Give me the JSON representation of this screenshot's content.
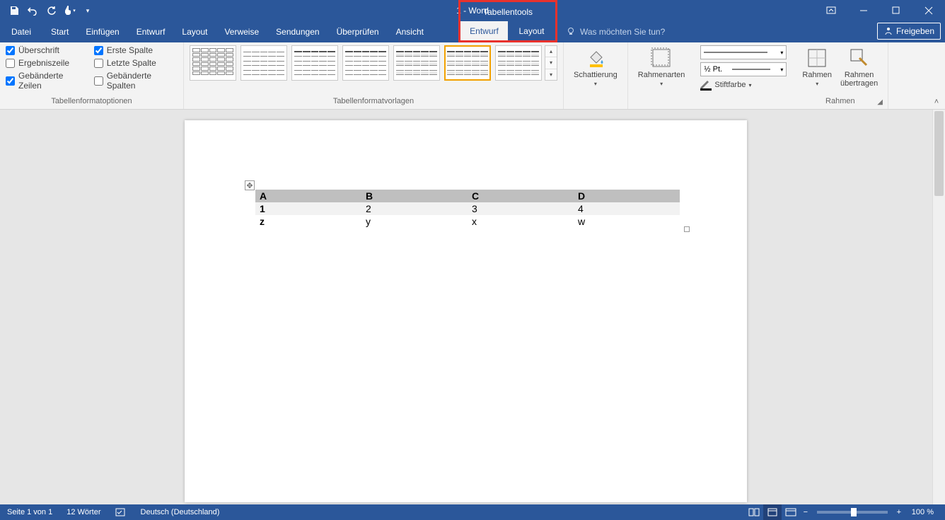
{
  "title": "1 - Word",
  "tabletools_label": "Tabellentools",
  "tabs": {
    "file": "Datei",
    "start": "Start",
    "insert": "Einfügen",
    "design": "Entwurf",
    "layout": "Layout",
    "references": "Verweise",
    "mailings": "Sendungen",
    "review": "Überprüfen",
    "view": "Ansicht",
    "ctx_design": "Entwurf",
    "ctx_layout": "Layout"
  },
  "tell_me_placeholder": "Was möchten Sie tun?",
  "share_label": "Freigeben",
  "groups": {
    "style_options": "Tabellenformatoptionen",
    "table_styles": "Tabellenformatvorlagen",
    "borders": "Rahmen"
  },
  "options": {
    "header_row": "Überschrift",
    "total_row": "Ergebniszeile",
    "banded_rows": "Gebänderte Zeilen",
    "first_col": "Erste Spalte",
    "last_col": "Letzte Spalte",
    "banded_cols": "Gebänderte Spalten"
  },
  "options_checked": {
    "header_row": true,
    "total_row": false,
    "banded_rows": true,
    "first_col": true,
    "last_col": false,
    "banded_cols": false
  },
  "ribbon_buttons": {
    "shading": "Schattierung",
    "border_styles": "Rahmenarten",
    "borders": "Rahmen",
    "border_painter_1": "Rahmen",
    "border_painter_2": "übertragen",
    "pen_color": "Stiftfarbe",
    "pen_weight": "½ Pt."
  },
  "table": {
    "rows": [
      [
        "A",
        "B",
        "C",
        "D"
      ],
      [
        "1",
        "2",
        "3",
        "4"
      ],
      [
        "z",
        "y",
        "x",
        "w"
      ]
    ]
  },
  "status": {
    "page": "Seite 1 von 1",
    "words": "12 Wörter",
    "language": "Deutsch (Deutschland)",
    "zoom": "100 %"
  }
}
